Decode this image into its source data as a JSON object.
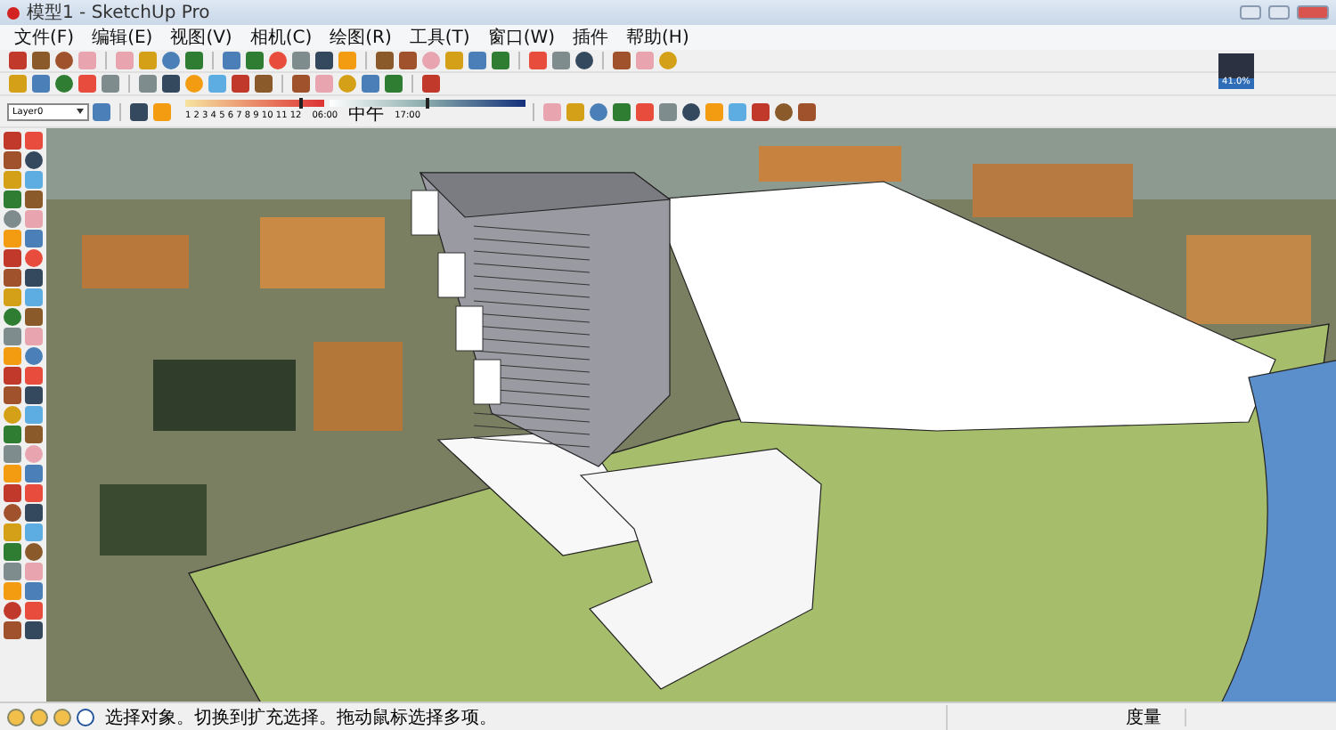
{
  "window": {
    "title": "模型1 - SketchUp Pro"
  },
  "menu": [
    "文件(F)",
    "编辑(E)",
    "视图(V)",
    "相机(C)",
    "绘图(R)",
    "工具(T)",
    "窗口(W)",
    "插件",
    "帮助(H)"
  ],
  "layer_select": {
    "value": "Layer0"
  },
  "shadow_settings": {
    "month_slider": {
      "level": 0.83
    },
    "time_slider": {
      "level": 0.5
    },
    "month_ticks": "1 2 3 4 5 6 7 8 9 10 11 12",
    "time_start": "06:00",
    "time_mid": "中午",
    "time_end": "17:00"
  },
  "progress_badge": {
    "text": "41.0%"
  },
  "status_bar": {
    "hint": "选择对象。切换到扩充选择。拖动鼠标选择多项。",
    "measure_label": "度量"
  }
}
